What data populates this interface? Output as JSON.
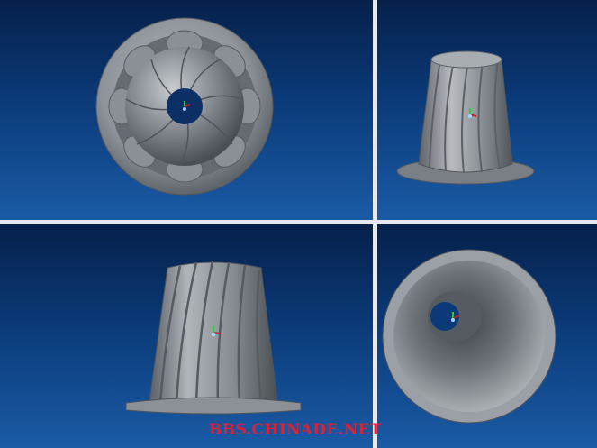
{
  "toolbar": {
    "buttons": [
      {
        "icon": "zoom-fit-icon"
      },
      {
        "icon": "zoom-in-icon"
      },
      {
        "icon": "zoom-out-icon"
      },
      {
        "icon": "repaint-icon"
      },
      {
        "icon": "shading-icon"
      },
      {
        "icon": "named-view-icon"
      },
      {
        "icon": "camera-icon"
      },
      {
        "icon": "datum-plane-icon"
      },
      {
        "icon": "datum-axis-icon"
      },
      {
        "icon": "datum-point-icon"
      },
      {
        "icon": "coordinate-system-icon"
      },
      {
        "icon": "spin-center-icon"
      },
      {
        "icon": "annotation-icon"
      },
      {
        "icon": "view-manager-icon"
      },
      {
        "icon": "appearance-icon"
      }
    ]
  },
  "viewports": {
    "top_left": "Top view",
    "top_right": "Isometric view",
    "bottom_left": "Front view",
    "bottom_right": "Bottom view"
  },
  "watermark": {
    "text": "BBS.CHINADE.NET"
  },
  "colors": {
    "background_top": "#06204a",
    "background_bottom": "#1a5ba6",
    "model": "#8e949b",
    "watermark": "#d6233a"
  }
}
